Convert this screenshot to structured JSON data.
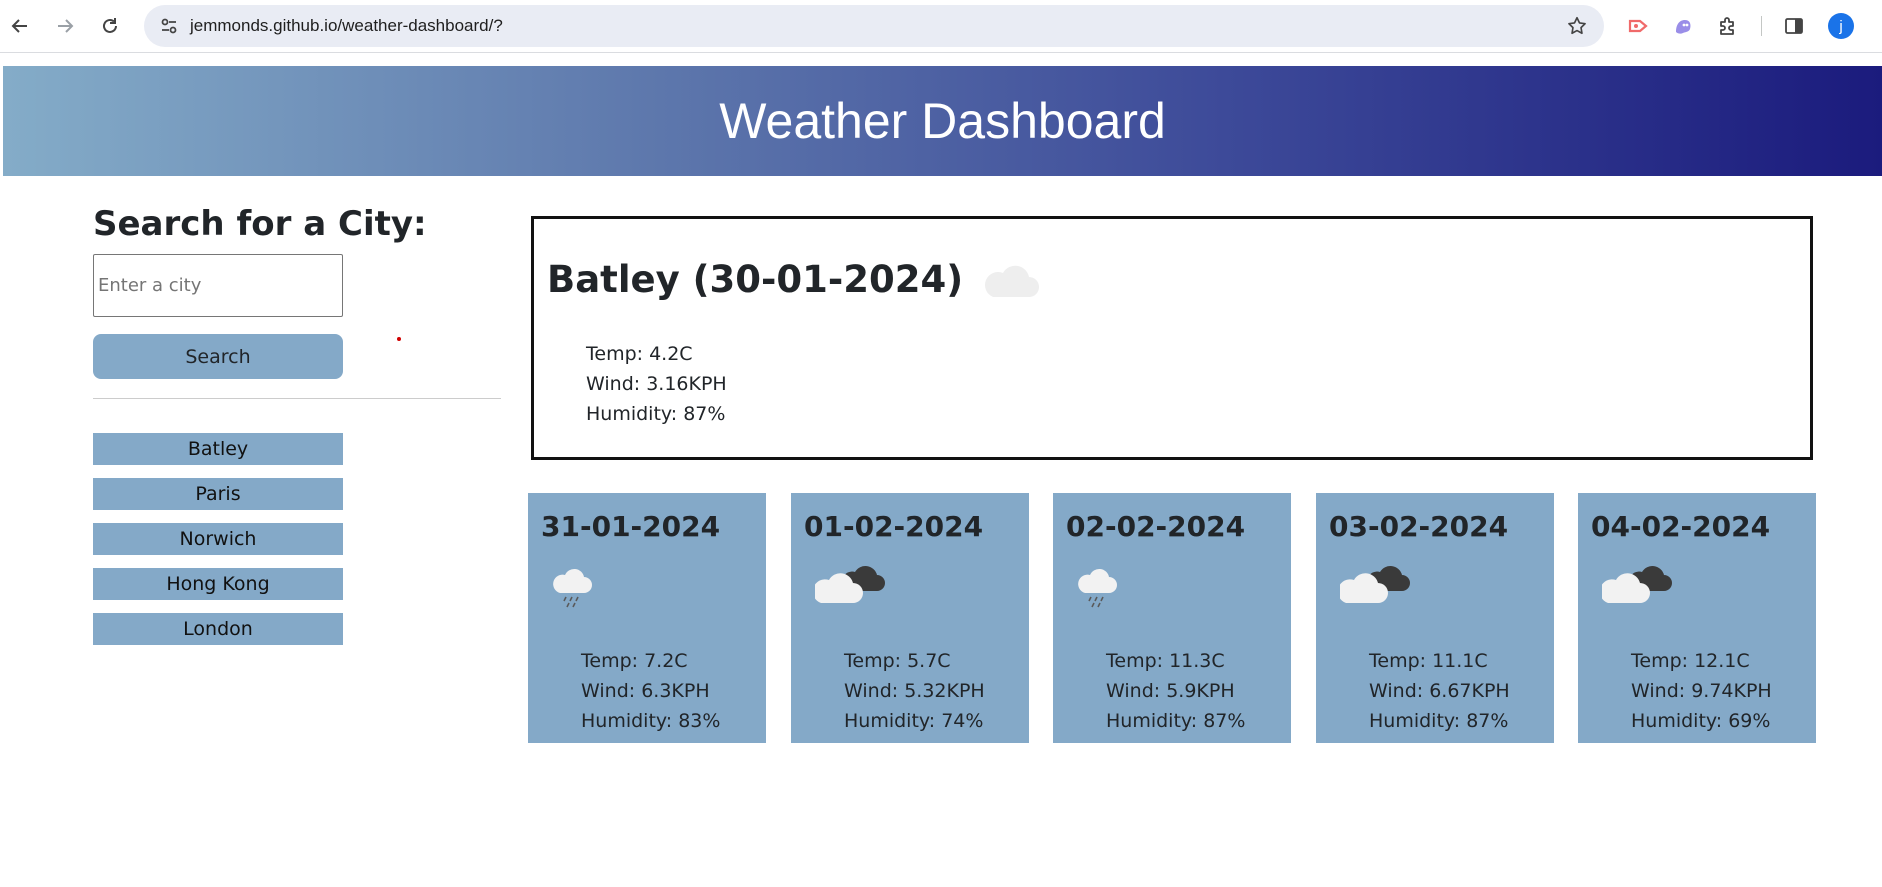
{
  "browser": {
    "url": "jemmonds.github.io/weather-dashboard/?",
    "profile_initial": "j"
  },
  "header": {
    "title": "Weather Dashboard"
  },
  "sidebar": {
    "heading": "Search for a City:",
    "input_placeholder": "Enter a city",
    "input_value": "",
    "search_label": "Search",
    "history": [
      "Batley",
      "Paris",
      "Norwich",
      "Hong Kong",
      "London"
    ]
  },
  "current": {
    "title": "Batley (30-01-2024)",
    "icon": "cloud-icon",
    "temp": "Temp: 4.2C",
    "wind": "Wind: 3.16KPH",
    "humidity": "Humidity: 87%"
  },
  "forecast": [
    {
      "date": "31-01-2024",
      "icon": "rain-cloud-night-icon",
      "temp": "Temp: 7.2C",
      "wind": "Wind: 6.3KPH",
      "humidity": "Humidity: 83%"
    },
    {
      "date": "01-02-2024",
      "icon": "broken-clouds-icon",
      "temp": "Temp: 5.7C",
      "wind": "Wind: 5.32KPH",
      "humidity": "Humidity: 74%"
    },
    {
      "date": "02-02-2024",
      "icon": "rain-cloud-night-icon",
      "temp": "Temp: 11.3C",
      "wind": "Wind: 5.9KPH",
      "humidity": "Humidity: 87%"
    },
    {
      "date": "03-02-2024",
      "icon": "broken-clouds-icon",
      "temp": "Temp: 11.1C",
      "wind": "Wind: 6.67KPH",
      "humidity": "Humidity: 87%"
    },
    {
      "date": "04-02-2024",
      "icon": "broken-clouds-icon",
      "temp": "Temp: 12.1C",
      "wind": "Wind: 9.74KPH",
      "humidity": "Humidity: 69%"
    }
  ],
  "colors": {
    "accent": "#84a9c8",
    "header_gradient_start": "#84acc8",
    "header_gradient_end": "#1b1b7d"
  }
}
